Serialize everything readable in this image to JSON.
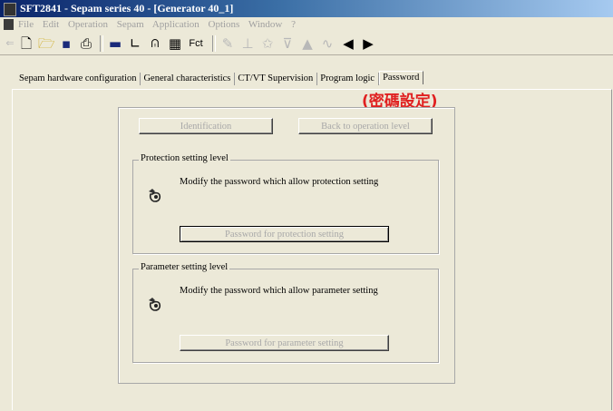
{
  "window": {
    "title": "SFT2841 - Sepam series 40 - [Generator 40_1]"
  },
  "menubar": {
    "items": [
      "File",
      "Edit",
      "Operation",
      "Sepam",
      "Application",
      "Options",
      "Window",
      "?"
    ]
  },
  "toolbar": {
    "fct_label": "Fct"
  },
  "tabs": [
    "Sepam hardware configuration",
    "General characteristics",
    "CT/VT Supervision",
    "Program logic",
    "Password"
  ],
  "annotation": "(密碼設定)",
  "buttons": {
    "identification": "Identification",
    "back_to_operation": "Back to operation level"
  },
  "protection_group": {
    "legend": "Protection setting level",
    "description": "Modify the password which allow protection setting",
    "button": "Password for protection setting"
  },
  "parameter_group": {
    "legend": "Parameter setting level",
    "description": "Modify the password which allow parameter setting",
    "button": "Password for parameter setting"
  }
}
